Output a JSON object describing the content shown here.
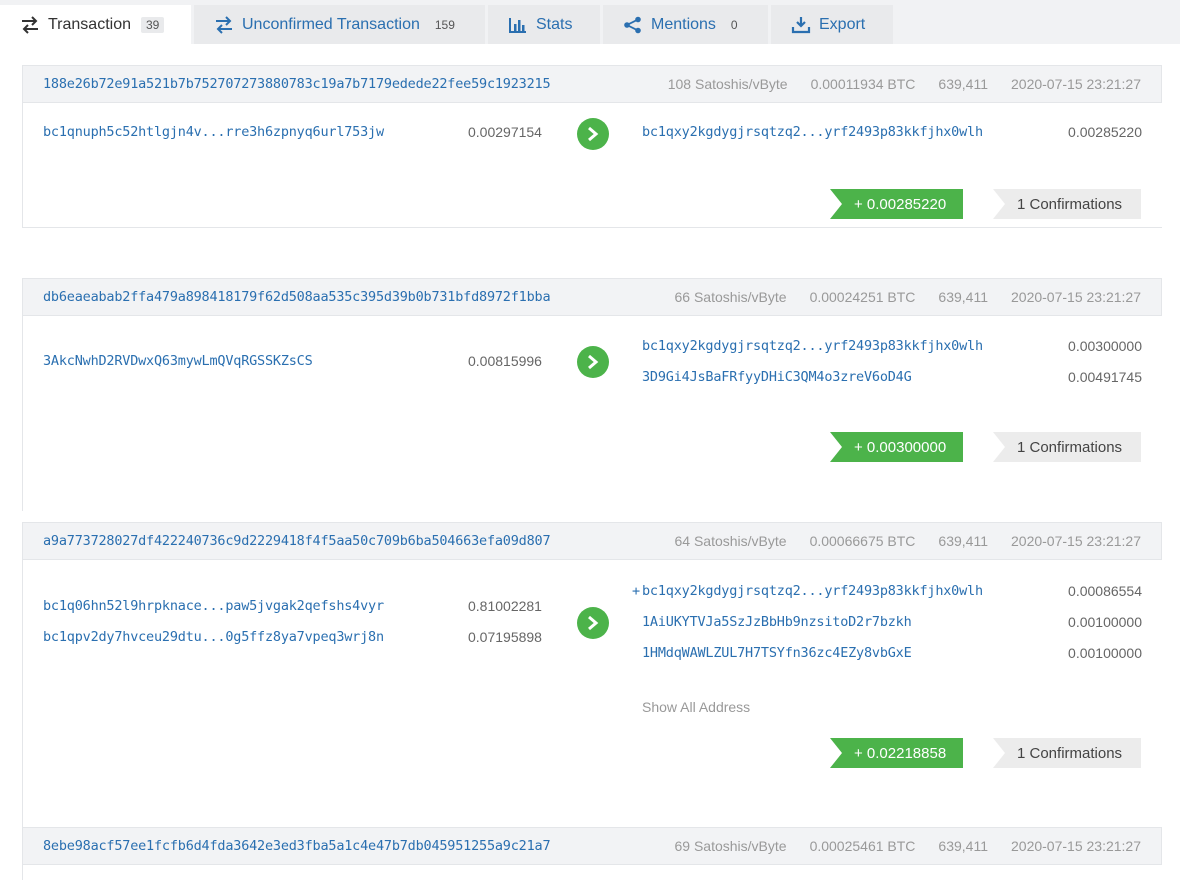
{
  "tabs": [
    {
      "label": "Transaction",
      "count": "39",
      "icon": "transfer-icon"
    },
    {
      "label": "Unconfirmed Transaction",
      "count": "159",
      "icon": "transfer-icon"
    },
    {
      "label": "Stats",
      "count": "",
      "icon": "bar-chart-icon"
    },
    {
      "label": "Mentions",
      "count": "0",
      "icon": "share-icon"
    },
    {
      "label": "Export",
      "count": "",
      "icon": "download-icon"
    }
  ],
  "colors": {
    "accent": "#2a6fb0",
    "green": "#4cb34a"
  },
  "transactions": [
    {
      "hash": "188e26b72e91a521b7b752707273880783c19a7b7179edede22fee59c1923215",
      "fee_rate": "108 Satoshis/vByte",
      "fee": "0.00011934 BTC",
      "block": "639,411",
      "time": "2020-07-15 23:21:27",
      "inputs": [
        {
          "address": "bc1qnuph5c52htlgjn4v...rre3h6zpnyq6url753jw",
          "amount": "0.00297154"
        }
      ],
      "outputs": [
        {
          "address": "bc1qxy2kgdygjrsqtzq2...yrf2493p83kkfjhx0wlh",
          "amount": "0.00285220"
        }
      ],
      "total": "+ 0.00285220",
      "confirmations": "1 Confirmations"
    },
    {
      "hash": "db6eaeabab2ffa479a898418179f62d508aa535c395d39b0b731bfd8972f1bba",
      "fee_rate": "66 Satoshis/vByte",
      "fee": "0.00024251 BTC",
      "block": "639,411",
      "time": "2020-07-15 23:21:27",
      "inputs": [
        {
          "address": "3AkcNwhD2RVDwxQ63mywLmQVqRGSSKZsCS",
          "amount": "0.00815996"
        }
      ],
      "outputs": [
        {
          "address": "bc1qxy2kgdygjrsqtzq2...yrf2493p83kkfjhx0wlh",
          "amount": "0.00300000"
        },
        {
          "address": "3D9Gi4JsBaFRfyyDHiC3QM4o3zreV6oD4G",
          "amount": "0.00491745"
        }
      ],
      "total": "+ 0.00300000",
      "confirmations": "1 Confirmations"
    },
    {
      "hash": "a9a773728027df422240736c9d2229418f4f5aa50c709b6ba504663efa09d807",
      "fee_rate": "64 Satoshis/vByte",
      "fee": "0.00066675 BTC",
      "block": "639,411",
      "time": "2020-07-15 23:21:27",
      "inputs": [
        {
          "address": "bc1q06hn52l9hrpknace...paw5jvgak2qefshs4vyr",
          "amount": "0.81002281"
        },
        {
          "address": "bc1qpv2dy7hvceu29dtu...0g5ffz8ya7vpeq3wrj8n",
          "amount": "0.07195898"
        }
      ],
      "outputs": [
        {
          "prefix": "+",
          "address": "bc1qxy2kgdygjrsqtzq2...yrf2493p83kkfjhx0wlh",
          "amount": "0.00086554"
        },
        {
          "address": "1AiUKYTVJa5SzJzBbHb9nzsitoD2r7bzkh",
          "amount": "0.00100000"
        },
        {
          "address": "1HMdqWAWLZUL7H7TSYfn36zc4EZy8vbGxE",
          "amount": "0.00100000"
        }
      ],
      "show_all": "Show All Address",
      "total": "+ 0.02218858",
      "confirmations": "1 Confirmations"
    },
    {
      "hash": "8ebe98acf57ee1fcfb6d4fda3642e3ed3fba5a1c4e47b7db045951255a9c21a7",
      "fee_rate": "69 Satoshis/vByte",
      "fee": "0.00025461 BTC",
      "block": "639,411",
      "time": "2020-07-15 23:21:27"
    }
  ]
}
